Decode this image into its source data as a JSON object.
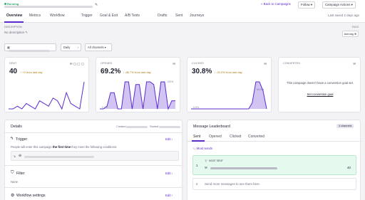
{
  "header": {
    "status": "Running",
    "back_label": "« Back to Campaigns",
    "follow_label": "Follow ▾",
    "campaign_actions_label": "Campaign Actions ▾"
  },
  "tabs": [
    {
      "label": "Overview",
      "active": true
    },
    {
      "label": "Metrics"
    },
    {
      "label": "Workflow"
    },
    {
      "label": "Trigger"
    },
    {
      "label": "Goal & Exit"
    },
    {
      "label": "A/B Tests"
    },
    {
      "label": "Drafts"
    },
    {
      "label": "Sent"
    },
    {
      "label": "Journeys"
    }
  ],
  "saved_text": "Last saved 2 days ago",
  "description": {
    "label": "DESCRIPTION",
    "value": "No description ✎"
  },
  "tags": {
    "label": "TAGS",
    "add_label": "Add tag ⊕"
  },
  "filters": {
    "period": "Daily",
    "channels": "All channels"
  },
  "cards": [
    {
      "label": "SENT",
      "value": "40",
      "delta": "↑ +3 from last day",
      "pct_top": "",
      "pct_bottom": "0",
      "spark": [
        0,
        0,
        1,
        0,
        2,
        1,
        0,
        3,
        2,
        1,
        4,
        3,
        0,
        6,
        2,
        1,
        0,
        10
      ]
    },
    {
      "label": "OPENED",
      "value": "69.2%",
      "delta": "↓ -86.7% from last day",
      "pct_top": "100%",
      "pct_bottom": "0.0%",
      "spark": [
        0,
        0,
        1,
        6,
        6,
        0,
        0,
        10,
        10,
        0,
        9,
        9,
        0,
        10,
        10,
        9,
        0,
        10,
        10,
        0,
        3,
        3
      ]
    },
    {
      "label": "CLICKED",
      "value": "30.8%",
      "delta": "↓ -20.0% from last day",
      "pct_top": "50.0%",
      "pct_bottom": "0.0%",
      "spark": [
        0,
        0,
        0,
        0,
        0,
        0,
        0,
        0,
        0,
        0,
        0,
        0,
        0,
        0,
        0,
        0,
        0,
        2,
        9,
        9,
        6,
        0
      ]
    },
    {
      "label": "CONVERTED",
      "value": "",
      "delta": "",
      "message": "This campaign doesn't have a conversion goal set.",
      "link": "Set conversion goal"
    }
  ],
  "details": {
    "title": "Details",
    "created_label": "Created",
    "started_label": "Started",
    "trigger_title": "Trigger",
    "trigger_edit": "Edit ›",
    "trigger_text_pre": "People will enter this campaign",
    "trigger_text_bold": "the first time",
    "trigger_text_post": "they meet the following conditions:",
    "filter_title": "Filter",
    "filter_edit": "Edit ›",
    "filter_value": "None",
    "workflow_title": "Workflow settings",
    "workflow_edit": "Edit ›"
  },
  "leaderboard": {
    "title": "Message Leaderboard",
    "channels_badge": "4 channels",
    "tabs": [
      "Sent",
      "Opened",
      "Clicked",
      "Converted"
    ],
    "sort_label": "↑↓ Most sends",
    "row1_rank": "1",
    "row1_badge": "MOST SENT",
    "row1_value": "40",
    "row2_rank": "2",
    "row2_text": "Send more messages to see them here."
  },
  "colors": {
    "accent": "#5b2bd1",
    "running": "#2fb673",
    "highlight": "#e6f9ef"
  }
}
